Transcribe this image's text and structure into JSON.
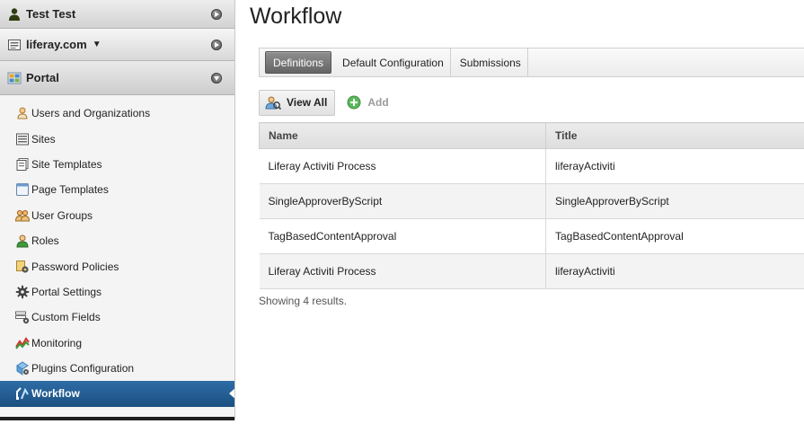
{
  "sidebar": {
    "user_name": "Test Test",
    "site_name": "liferay.com",
    "site_caret": "▼",
    "portal_label": "Portal",
    "items": [
      {
        "label": "Users and Organizations",
        "icon": "users-orgs-icon"
      },
      {
        "label": "Sites",
        "icon": "sites-icon"
      },
      {
        "label": "Site Templates",
        "icon": "site-templates-icon"
      },
      {
        "label": "Page Templates",
        "icon": "page-templates-icon"
      },
      {
        "label": "User Groups",
        "icon": "user-groups-icon"
      },
      {
        "label": "Roles",
        "icon": "roles-icon"
      },
      {
        "label": "Password Policies",
        "icon": "password-policies-icon"
      },
      {
        "label": "Portal Settings",
        "icon": "gear-icon"
      },
      {
        "label": "Custom Fields",
        "icon": "custom-fields-icon"
      },
      {
        "label": "Monitoring",
        "icon": "monitoring-icon"
      },
      {
        "label": "Plugins Configuration",
        "icon": "plugins-icon"
      },
      {
        "label": "Workflow",
        "icon": "workflow-icon",
        "active": true
      }
    ]
  },
  "main": {
    "title": "Workflow",
    "tabs": [
      {
        "label": "Definitions",
        "selected": true
      },
      {
        "label": "Default Configuration"
      },
      {
        "label": "Submissions"
      }
    ],
    "toolbar": {
      "view_all": "View All",
      "add": "Add"
    },
    "table": {
      "columns": [
        "Name",
        "Title"
      ],
      "rows": [
        [
          "Liferay Activiti Process",
          "liferayActiviti"
        ],
        [
          "SingleApproverByScript",
          "SingleApproverByScript"
        ],
        [
          "TagBasedContentApproval",
          "TagBasedContentApproval"
        ],
        [
          "Liferay Activiti Process",
          "liferayActiviti"
        ]
      ]
    },
    "results_text": "Showing 4 results."
  },
  "colors": {
    "active_nav": "#2e6da6",
    "selected_tab": "#777777",
    "add_icon": "#4caf50"
  }
}
